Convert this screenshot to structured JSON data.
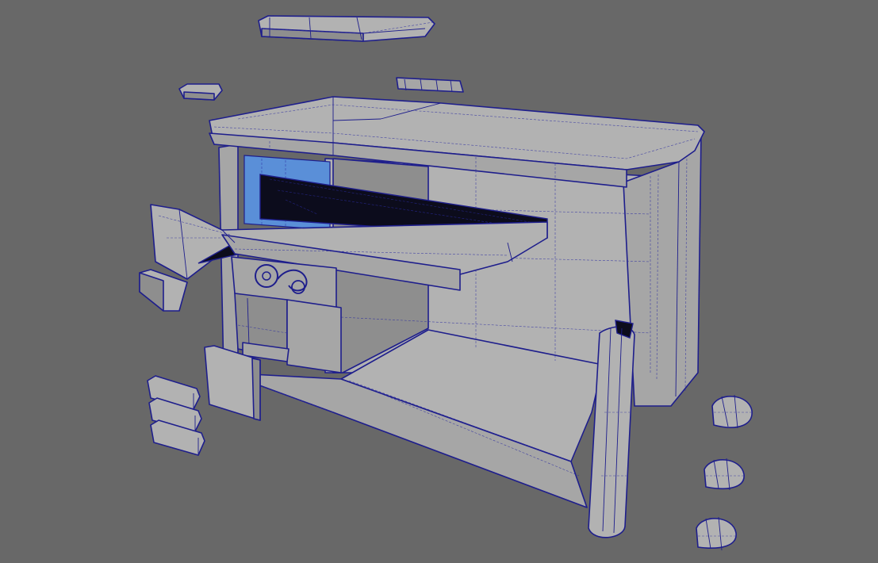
{
  "viewport": {
    "background": "#686868",
    "wireframe_color": "#1e1e8c",
    "surface_color": "#a6a6a6",
    "highlight_color": "#5a8fd8"
  },
  "objects": [
    "roof-slab",
    "small-block",
    "roof-trim-bar",
    "cabinet-body",
    "counter-top",
    "awning",
    "window-glass",
    "display-screen",
    "emblem-panel",
    "lower-door",
    "side-panel",
    "vent-grate",
    "stacked-bricks",
    "corner-post",
    "dome-caps"
  ]
}
